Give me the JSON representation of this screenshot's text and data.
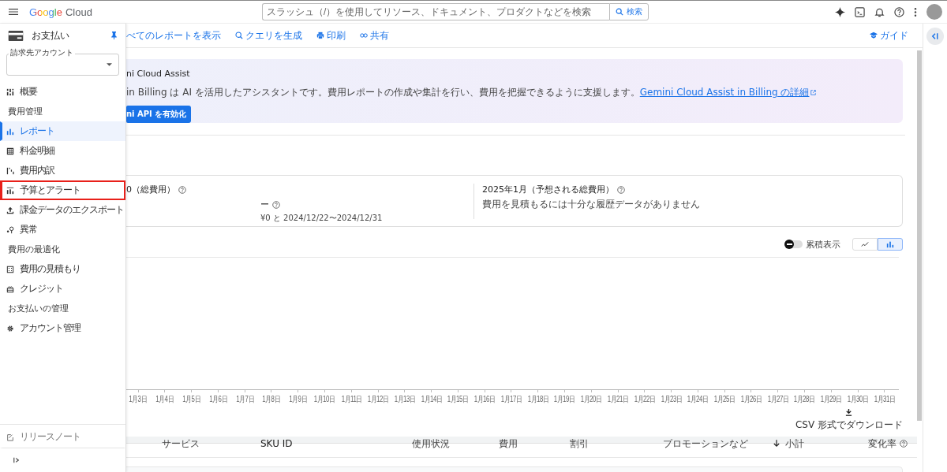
{
  "header": {
    "logo_brand": "Google",
    "logo_product": "Cloud",
    "search": {
      "placeholder": "スラッシュ（/）を使用してリソース、ドキュメント、プロダクトなどを検索",
      "button": "検索"
    }
  },
  "sidebar": {
    "title": "お支払い",
    "account_field": {
      "label": "請求先アカウント"
    },
    "items": [
      {
        "kind": "item",
        "label": "概要",
        "selected": false,
        "highlighted": false
      },
      {
        "kind": "section",
        "label": "費用管理"
      },
      {
        "kind": "item",
        "label": "レポート",
        "selected": true,
        "highlighted": false
      },
      {
        "kind": "item",
        "label": "料金明細",
        "selected": false,
        "highlighted": false
      },
      {
        "kind": "item",
        "label": "費用内訳",
        "selected": false,
        "highlighted": false
      },
      {
        "kind": "item",
        "label": "予算とアラート",
        "selected": false,
        "highlighted": true
      },
      {
        "kind": "item",
        "label": "課金データのエクスポート",
        "selected": false,
        "highlighted": false
      },
      {
        "kind": "item",
        "label": "異常",
        "selected": false,
        "highlighted": false
      },
      {
        "kind": "section",
        "label": "費用の最適化"
      },
      {
        "kind": "item",
        "label": "費用の見積もり",
        "selected": false,
        "highlighted": false
      },
      {
        "kind": "item",
        "label": "クレジット",
        "selected": false,
        "highlighted": false
      },
      {
        "kind": "section",
        "label": "お支払いの管理"
      },
      {
        "kind": "item",
        "label": "アカウント管理",
        "selected": false,
        "highlighted": false
      }
    ],
    "release_notes": "リリースノート"
  },
  "toolbar": {
    "actions": [
      "べてのレポートを表示",
      "クエリを生成",
      "印刷",
      "共有"
    ],
    "guide": "ガイド"
  },
  "banner": {
    "title": "ni Cloud Assist",
    "text": "in Billing は AI を活用したアシスタントです。費用レポートの作成や集計を行い、費用を把握できるように支援します。",
    "link": "Gemini Cloud Assist in Billing の詳細",
    "button": "ni API を有効化"
  },
  "summary": {
    "left_title": "0（総費用）",
    "dash": "ー",
    "range": "¥0 と 2024/12/22〜2024/12/31",
    "right_title": "2025年1月（予想される総費用）",
    "right_text": "費用を見積もるには十分な履歴データがありません"
  },
  "chart_controls": {
    "cumulative": {
      "label": "累積表示",
      "on": false
    },
    "chart_types": [
      {
        "kind": "line",
        "selected": false
      },
      {
        "kind": "bar",
        "selected": true
      }
    ]
  },
  "chart": {
    "x_labels": [
      "1月3日",
      "1月4日",
      "1月5日",
      "1月6日",
      "1月7日",
      "1月8日",
      "1月9日",
      "1月10日",
      "1月11日",
      "1月12日",
      "1月13日",
      "1月14日",
      "1月15日",
      "1月16日",
      "1月17日",
      "1月18日",
      "1月19日",
      "1月20日",
      "1月21日",
      "1月22日",
      "1月23日",
      "1月24日",
      "1月25日",
      "1月26日",
      "1月27日",
      "1月28日",
      "1月29日",
      "1月30日",
      "1月31日"
    ]
  },
  "csv_download": "CSV 形式でダウンロード",
  "table": {
    "columns": [
      {
        "label": "サービス",
        "sorted": false,
        "help": false
      },
      {
        "label": "SKU ID",
        "sorted": false,
        "help": false
      },
      {
        "label": "使用状況",
        "sorted": false,
        "help": false
      },
      {
        "label": "費用",
        "sorted": false,
        "help": false
      },
      {
        "label": "割引",
        "sorted": false,
        "help": false
      },
      {
        "label": "プロモーションなど",
        "sorted": false,
        "help": false
      },
      {
        "label": "小計",
        "sorted": true,
        "help": false
      },
      {
        "label": "変化率",
        "sorted": false,
        "help": true
      }
    ]
  }
}
